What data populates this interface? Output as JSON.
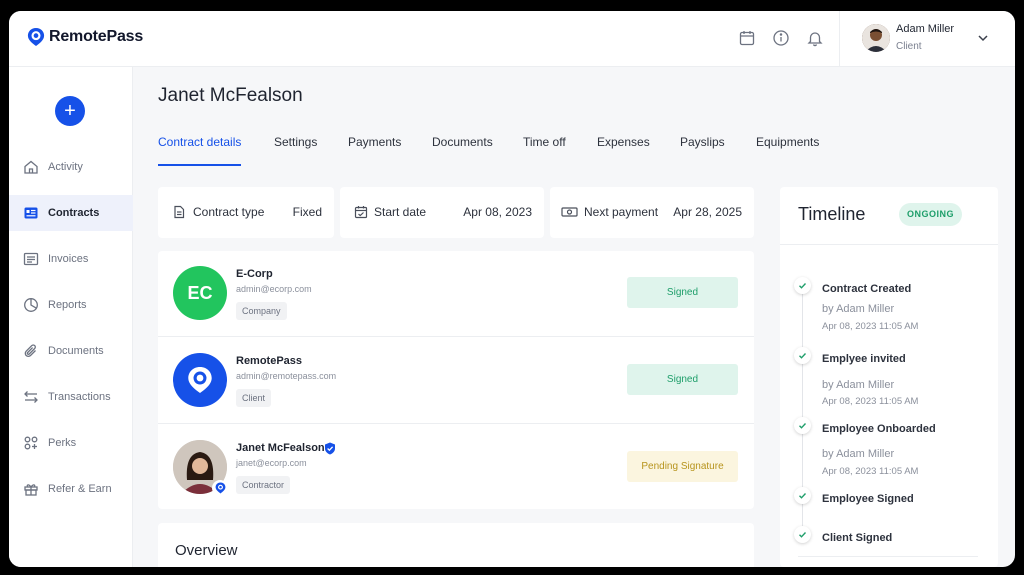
{
  "brand": {
    "name": "RemotePass",
    "accent": "#1651e8",
    "success": "#1e9e6a",
    "warning": "#b7941d"
  },
  "topbar": {
    "icons": [
      "calendar-icon",
      "info-icon",
      "bell-icon"
    ],
    "user": {
      "name": "Adam Miller",
      "role": "Client"
    }
  },
  "sidebar": {
    "add_button": "+",
    "items": [
      {
        "label": "Activity",
        "icon": "home-icon",
        "active": false
      },
      {
        "label": "Contracts",
        "icon": "contract-card-icon",
        "active": true
      },
      {
        "label": "Invoices",
        "icon": "invoice-icon",
        "active": false
      },
      {
        "label": "Reports",
        "icon": "pie-chart-icon",
        "active": false
      },
      {
        "label": "Documents",
        "icon": "paperclip-icon",
        "active": false
      },
      {
        "label": "Transactions",
        "icon": "arrows-icon",
        "active": false
      },
      {
        "label": "Perks",
        "icon": "perks-icon",
        "active": false
      },
      {
        "label": "Refer & Earn",
        "icon": "gift-icon",
        "active": false
      }
    ]
  },
  "page": {
    "title": "Janet McFealson",
    "tabs": [
      "Contract details",
      "Settings",
      "Payments",
      "Documents",
      "Time off",
      "Expenses",
      "Payslips",
      "Equipments"
    ],
    "active_tab": "Contract details"
  },
  "info_cards": [
    {
      "label": "Contract type",
      "value": "Fixed",
      "icon": "document-icon"
    },
    {
      "label": "Start date",
      "value": "Apr 08, 2023",
      "icon": "calendar-check-icon"
    },
    {
      "label": "Next payment",
      "value": "Apr 28, 2025",
      "icon": "money-icon"
    }
  ],
  "parties": [
    {
      "logo_text": "EC",
      "logo_color": "#22c55e",
      "name": "E-Corp",
      "email": "admin@ecorp.com",
      "tag": "Company",
      "status": "Signed"
    },
    {
      "logo_text": "",
      "logo_color": "#1651e8",
      "name": "RemotePass",
      "email": "admin@remotepass.com",
      "tag": "Client",
      "status": "Signed"
    },
    {
      "logo_text": "",
      "logo_color": "#d9d2cc",
      "name": "Janet McFealson",
      "email": "janet@ecorp.com",
      "tag": "Contractor",
      "status": "Pending Signature",
      "verified": true
    }
  ],
  "overview": {
    "title": "Overview"
  },
  "timeline": {
    "title": "Timeline",
    "status": "ONGOING",
    "events": [
      {
        "title": "Contract Created",
        "by": "by Adam Miller",
        "time": "Apr 08, 2023 11:05 AM"
      },
      {
        "title": "Emplyee invited",
        "by": "by Adam Miller",
        "time": "Apr 08, 2023 11:05 AM"
      },
      {
        "title": "Employee Onboarded",
        "by": "by Adam Miller",
        "time": "Apr 08, 2023 11:05 AM"
      },
      {
        "title": "Employee Signed",
        "by": "",
        "time": ""
      },
      {
        "title": "Client Signed",
        "by": "",
        "time": ""
      }
    ]
  }
}
